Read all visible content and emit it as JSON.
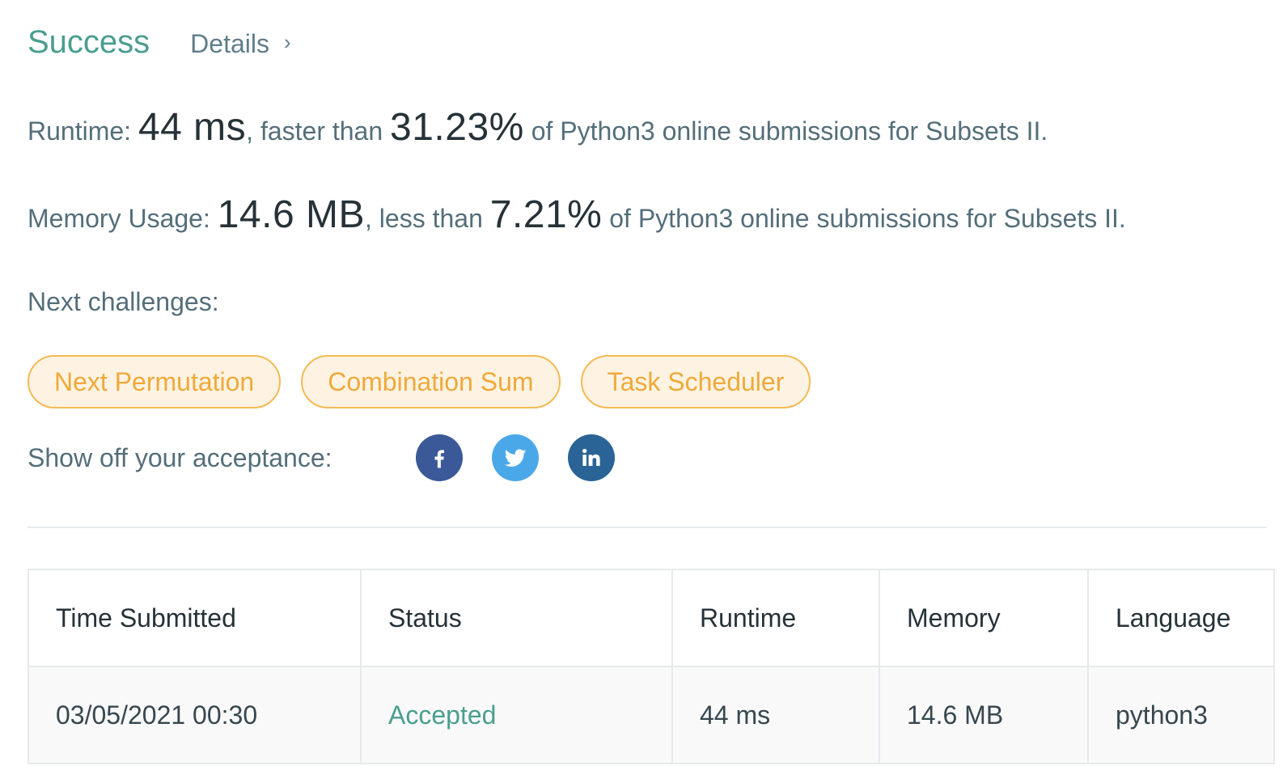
{
  "header": {
    "status": "Success",
    "details_label": "Details",
    "chevron_glyph": "›"
  },
  "runtime": {
    "label": "Runtime:",
    "value": "44 ms",
    "comparison": ", faster than",
    "percent": "31.23%",
    "suffix": "of Python3 online submissions for Subsets II."
  },
  "memory": {
    "label": "Memory Usage:",
    "value": "14.6 MB",
    "comparison": ", less than",
    "percent": "7.21%",
    "suffix": "of Python3 online submissions for Subsets II."
  },
  "next_challenges": {
    "label": "Next challenges:",
    "items": [
      {
        "label": "Next Permutation"
      },
      {
        "label": "Combination Sum"
      },
      {
        "label": "Task Scheduler"
      }
    ]
  },
  "share": {
    "label": "Show off your acceptance:",
    "icons": [
      "facebook-icon",
      "twitter-icon",
      "linkedin-icon"
    ]
  },
  "submissions": {
    "columns": [
      "Time Submitted",
      "Status",
      "Runtime",
      "Memory",
      "Language"
    ],
    "rows": [
      {
        "time": "03/05/2021 00:30",
        "status": "Accepted",
        "runtime": "44 ms",
        "memory": "14.6 MB",
        "language": "python3"
      }
    ]
  },
  "colors": {
    "success": "#4a9e8f",
    "chip_border": "#f5b955",
    "chip_text": "#f0a93a",
    "facebook": "#3b5998",
    "twitter": "#4aa8e8",
    "linkedin": "#2a6496"
  }
}
